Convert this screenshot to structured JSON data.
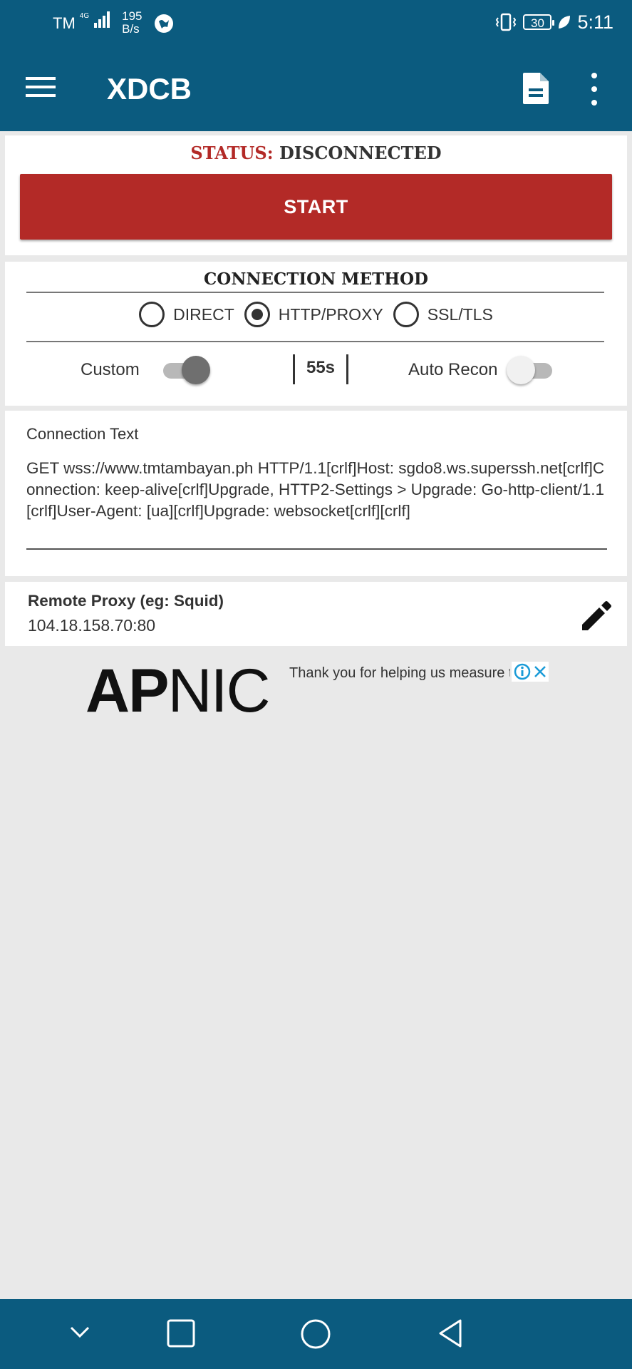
{
  "status_bar": {
    "carrier": "TM",
    "network": "4G",
    "speed_value": "195",
    "speed_unit": "B/s",
    "battery": "30",
    "time": "5:11"
  },
  "app_bar": {
    "title": "XDCB",
    "icons": [
      "menu-icon",
      "document-icon",
      "more-vert-icon"
    ]
  },
  "status_card": {
    "label": "STATUS:",
    "value": "DISCONNECTED",
    "start_button": "START",
    "accent_color": "#b32a27"
  },
  "connection_method": {
    "title": "CONNECTION METHOD",
    "options": [
      "DIRECT",
      "HTTP/PROXY",
      "SSL/TLS"
    ],
    "selected": "HTTP/PROXY",
    "custom_label": "Custom",
    "custom_enabled": true,
    "timer": "55s",
    "auto_recon_label": "Auto Recon",
    "auto_recon_enabled": false
  },
  "connection_text": {
    "label": "Connection Text",
    "value": "GET wss://www.tmtambayan.ph HTTP/1.1[crlf]Host: sgdo8.ws.superssh.net[crlf]Connection: keep-alive[crlf]Upgrade, HTTP2-Settings  > Upgrade: Go-http-client/1.1 [crlf]User-Agent: [ua][crlf]Upgrade: websocket[crlf][crlf]"
  },
  "remote_proxy": {
    "label": "Remote Proxy (eg: Squid)",
    "value": "104.18.158.70:80"
  },
  "ad": {
    "logo_bold": "AP",
    "logo_thin": "NIC",
    "text": "Thank you for helping us measure the Internet."
  },
  "theme": {
    "primary": "#0b5b7f",
    "background": "#e9e9e9"
  }
}
